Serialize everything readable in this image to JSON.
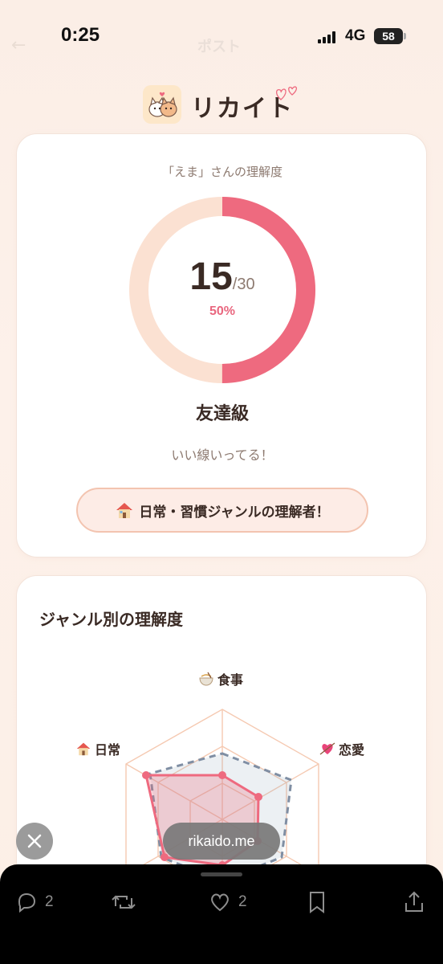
{
  "status": {
    "time": "0:25",
    "network": "4G",
    "battery": "58"
  },
  "background_post_title": "ポスト",
  "app": {
    "name": "リカイト"
  },
  "score": {
    "subtitle": "「えま」さんの理解度",
    "value": "15",
    "total": "/30",
    "percent_label": "50%",
    "fraction": 0.5,
    "rank": "友達級",
    "comment": "いい線いってる！",
    "badge_text": "日常・習慣ジャンルの理解者！"
  },
  "genre": {
    "title": "ジャンル別の理解度",
    "axes": [
      "食事",
      "恋愛",
      "日常"
    ]
  },
  "overlay": {
    "url": "rikaido.me"
  },
  "actions": {
    "reply_count": "2",
    "like_count": "2"
  },
  "colors": {
    "accent": "#ee6a7f",
    "ring_bg": "#fbe1d2",
    "dashed": "#7f8ea3"
  }
}
